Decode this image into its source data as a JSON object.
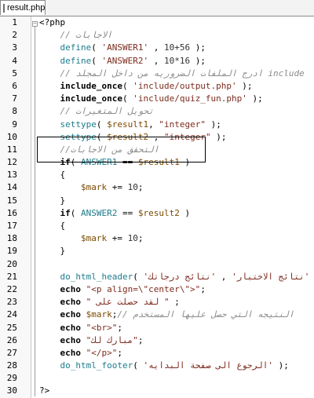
{
  "tab": {
    "title": "result.php"
  },
  "lines": [
    {
      "n": "1",
      "parts": [
        {
          "t": "<?php",
          "c": "kw0"
        }
      ]
    },
    {
      "n": "2",
      "parts": [
        {
          "t": "    // الاجابات",
          "c": "cm"
        }
      ]
    },
    {
      "n": "3",
      "parts": [
        {
          "t": "    define",
          "c": "const"
        },
        {
          "t": "( ",
          "c": ""
        },
        {
          "t": "'ANSWER1'",
          "c": "str"
        },
        {
          "t": " , ",
          "c": ""
        },
        {
          "t": "10+56",
          "c": "num"
        },
        {
          "t": " );",
          "c": ""
        }
      ]
    },
    {
      "n": "4",
      "parts": [
        {
          "t": "    define",
          "c": "const"
        },
        {
          "t": "( ",
          "c": ""
        },
        {
          "t": "'ANSWER2'",
          "c": "str"
        },
        {
          "t": " , ",
          "c": ""
        },
        {
          "t": "10*16",
          "c": "num"
        },
        {
          "t": " );",
          "c": ""
        }
      ]
    },
    {
      "n": "5",
      "parts": [
        {
          "t": "    // ادرج الملفات الضروريه من داخل المجلد include",
          "c": "cm"
        }
      ]
    },
    {
      "n": "6",
      "parts": [
        {
          "t": "    include_once",
          "c": "kw"
        },
        {
          "t": "( ",
          "c": ""
        },
        {
          "t": "'include/output.php'",
          "c": "str"
        },
        {
          "t": " );",
          "c": ""
        }
      ]
    },
    {
      "n": "7",
      "parts": [
        {
          "t": "    include_once",
          "c": "kw"
        },
        {
          "t": "( ",
          "c": ""
        },
        {
          "t": "'include/quiz_fun.php'",
          "c": "str"
        },
        {
          "t": " );",
          "c": ""
        }
      ]
    },
    {
      "n": "8",
      "parts": [
        {
          "t": "    // تحويل المتغيرات",
          "c": "cm"
        }
      ]
    },
    {
      "n": "9",
      "parts": [
        {
          "t": "    settype",
          "c": "const"
        },
        {
          "t": "( ",
          "c": ""
        },
        {
          "t": "$result1",
          "c": "var"
        },
        {
          "t": ", ",
          "c": ""
        },
        {
          "t": "\"integer\"",
          "c": "str"
        },
        {
          "t": " );",
          "c": ""
        }
      ]
    },
    {
      "n": "10",
      "parts": [
        {
          "t": "    settype",
          "c": "const"
        },
        {
          "t": "( ",
          "c": ""
        },
        {
          "t": "$result2",
          "c": "var"
        },
        {
          "t": " , ",
          "c": ""
        },
        {
          "t": "\"integer\"",
          "c": "str"
        },
        {
          "t": " );",
          "c": ""
        }
      ]
    },
    {
      "n": "11",
      "parts": [
        {
          "t": "    //التحقق من الاجابات",
          "c": "cm"
        }
      ]
    },
    {
      "n": "12",
      "parts": [
        {
          "t": "    if",
          "c": "kw"
        },
        {
          "t": "( ",
          "c": ""
        },
        {
          "t": "ANSWER1",
          "c": "const"
        },
        {
          "t": " == ",
          "c": ""
        },
        {
          "t": "$result1",
          "c": "var"
        },
        {
          "t": " )",
          "c": ""
        }
      ]
    },
    {
      "n": "13",
      "parts": [
        {
          "t": "    {",
          "c": ""
        }
      ]
    },
    {
      "n": "14",
      "parts": [
        {
          "t": "        ",
          "c": ""
        },
        {
          "t": "$mark",
          "c": "var"
        },
        {
          "t": " += ",
          "c": ""
        },
        {
          "t": "10",
          "c": "num"
        },
        {
          "t": ";",
          "c": ""
        }
      ]
    },
    {
      "n": "15",
      "parts": [
        {
          "t": "    }",
          "c": ""
        }
      ]
    },
    {
      "n": "16",
      "parts": [
        {
          "t": "    if",
          "c": "kw"
        },
        {
          "t": "( ",
          "c": ""
        },
        {
          "t": "ANSWER2",
          "c": "const"
        },
        {
          "t": " == ",
          "c": ""
        },
        {
          "t": "$result2",
          "c": "var"
        },
        {
          "t": " )",
          "c": ""
        }
      ]
    },
    {
      "n": "17",
      "parts": [
        {
          "t": "    {",
          "c": ""
        }
      ]
    },
    {
      "n": "18",
      "parts": [
        {
          "t": "        ",
          "c": ""
        },
        {
          "t": "$mark",
          "c": "var"
        },
        {
          "t": " += ",
          "c": ""
        },
        {
          "t": "10",
          "c": "num"
        },
        {
          "t": ";",
          "c": ""
        }
      ]
    },
    {
      "n": "19",
      "parts": [
        {
          "t": "    }",
          "c": ""
        }
      ]
    },
    {
      "n": "20",
      "parts": [
        {
          "t": "",
          "c": ""
        }
      ]
    },
    {
      "n": "21",
      "parts": [
        {
          "t": "    do_html_header",
          "c": "const"
        },
        {
          "t": "( ",
          "c": ""
        },
        {
          "t": "'نتائج الاختبار'",
          "c": "str"
        },
        {
          "t": " , ",
          "c": ""
        },
        {
          "t": "'نتائج درجاتك'",
          "c": "str"
        },
        {
          "t": " );",
          "c": ""
        }
      ]
    },
    {
      "n": "22",
      "parts": [
        {
          "t": "    echo",
          "c": "kw"
        },
        {
          "t": " ",
          "c": ""
        },
        {
          "t": "\"<p align=\\\"center\\\">\"",
          "c": "str"
        },
        {
          "t": ";",
          "c": ""
        }
      ]
    },
    {
      "n": "23",
      "parts": [
        {
          "t": "    echo",
          "c": "kw"
        },
        {
          "t": " ",
          "c": ""
        },
        {
          "t": "\" لقد حصلت على \"",
          "c": "str"
        },
        {
          "t": " ;",
          "c": ""
        }
      ]
    },
    {
      "n": "24",
      "parts": [
        {
          "t": "    echo",
          "c": "kw"
        },
        {
          "t": " ",
          "c": ""
        },
        {
          "t": "$mark",
          "c": "var"
        },
        {
          "t": ";",
          "c": ""
        },
        {
          "t": "// النتيجه التي حصل عليها المستخدم",
          "c": "cm"
        }
      ]
    },
    {
      "n": "25",
      "parts": [
        {
          "t": "    echo",
          "c": "kw"
        },
        {
          "t": " ",
          "c": ""
        },
        {
          "t": "\"<br>\"",
          "c": "str"
        },
        {
          "t": ";",
          "c": ""
        }
      ]
    },
    {
      "n": "26",
      "parts": [
        {
          "t": "    echo",
          "c": "kw"
        },
        {
          "t": " ",
          "c": ""
        },
        {
          "t": "\"مبارك لك\"",
          "c": "str"
        },
        {
          "t": ";",
          "c": ""
        }
      ]
    },
    {
      "n": "27",
      "parts": [
        {
          "t": "    echo",
          "c": "kw"
        },
        {
          "t": " ",
          "c": ""
        },
        {
          "t": "\"</p>\"",
          "c": "str"
        },
        {
          "t": ";",
          "c": ""
        }
      ]
    },
    {
      "n": "28",
      "parts": [
        {
          "t": "    do_html_footer",
          "c": "const"
        },
        {
          "t": "( ",
          "c": ""
        },
        {
          "t": "'الرجوع الى صفحة البدايه'",
          "c": "str"
        },
        {
          "t": " );",
          "c": ""
        }
      ]
    },
    {
      "n": "29",
      "parts": [
        {
          "t": "",
          "c": ""
        }
      ]
    },
    {
      "n": "30",
      "parts": [
        {
          "t": "?>",
          "c": "kw0"
        }
      ]
    }
  ]
}
